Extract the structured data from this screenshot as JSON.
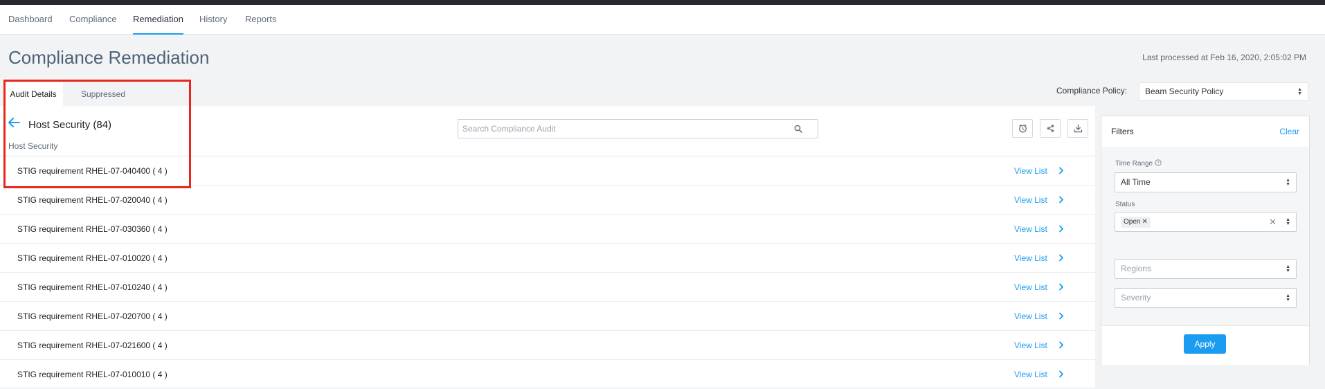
{
  "nav": {
    "tabs": [
      {
        "label": "Dashboard",
        "active": false
      },
      {
        "label": "Compliance",
        "active": false
      },
      {
        "label": "Remediation",
        "active": true
      },
      {
        "label": "History",
        "active": false
      },
      {
        "label": "Reports",
        "active": false
      }
    ]
  },
  "header": {
    "title": "Compliance Remediation",
    "last_processed": "Last processed at Feb 16, 2020, 2:05:02 PM"
  },
  "audit_tabs": [
    {
      "label": "Audit Details",
      "active": true
    },
    {
      "label": "Suppressed",
      "active": false
    }
  ],
  "policy": {
    "label": "Compliance Policy:",
    "value": "Beam Security Policy"
  },
  "section": {
    "title": "Host Security (84)",
    "subtitle": "Host Security"
  },
  "search": {
    "placeholder": "Search Compliance Audit",
    "value": ""
  },
  "toolbar": {
    "icons": [
      "clock-icon",
      "share-icon",
      "download-icon"
    ]
  },
  "list": {
    "rows": [
      {
        "label": "STIG requirement RHEL-07-040400 ( 4 )",
        "action": "View List"
      },
      {
        "label": "STIG requirement RHEL-07-020040 ( 4 )",
        "action": "View List"
      },
      {
        "label": "STIG requirement RHEL-07-030360 ( 4 )",
        "action": "View List"
      },
      {
        "label": "STIG requirement RHEL-07-010020 ( 4 )",
        "action": "View List"
      },
      {
        "label": "STIG requirement RHEL-07-010240 ( 4 )",
        "action": "View List"
      },
      {
        "label": "STIG requirement RHEL-07-020700 ( 4 )",
        "action": "View List"
      },
      {
        "label": "STIG requirement RHEL-07-021600 ( 4 )",
        "action": "View List"
      },
      {
        "label": "STIG requirement RHEL-07-010010 ( 4 )",
        "action": "View List"
      }
    ]
  },
  "filters": {
    "title": "Filters",
    "clear_label": "Clear",
    "time_range": {
      "label": "Time Range",
      "value": "All Time"
    },
    "status": {
      "label": "Status",
      "chips": [
        "Open"
      ]
    },
    "regions": {
      "placeholder": "Regions"
    },
    "severity": {
      "placeholder": "Severity"
    },
    "apply_label": "Apply"
  },
  "colors": {
    "accent": "#1a9cf0",
    "highlight": "#e8261c",
    "topbar": "#26292e"
  }
}
